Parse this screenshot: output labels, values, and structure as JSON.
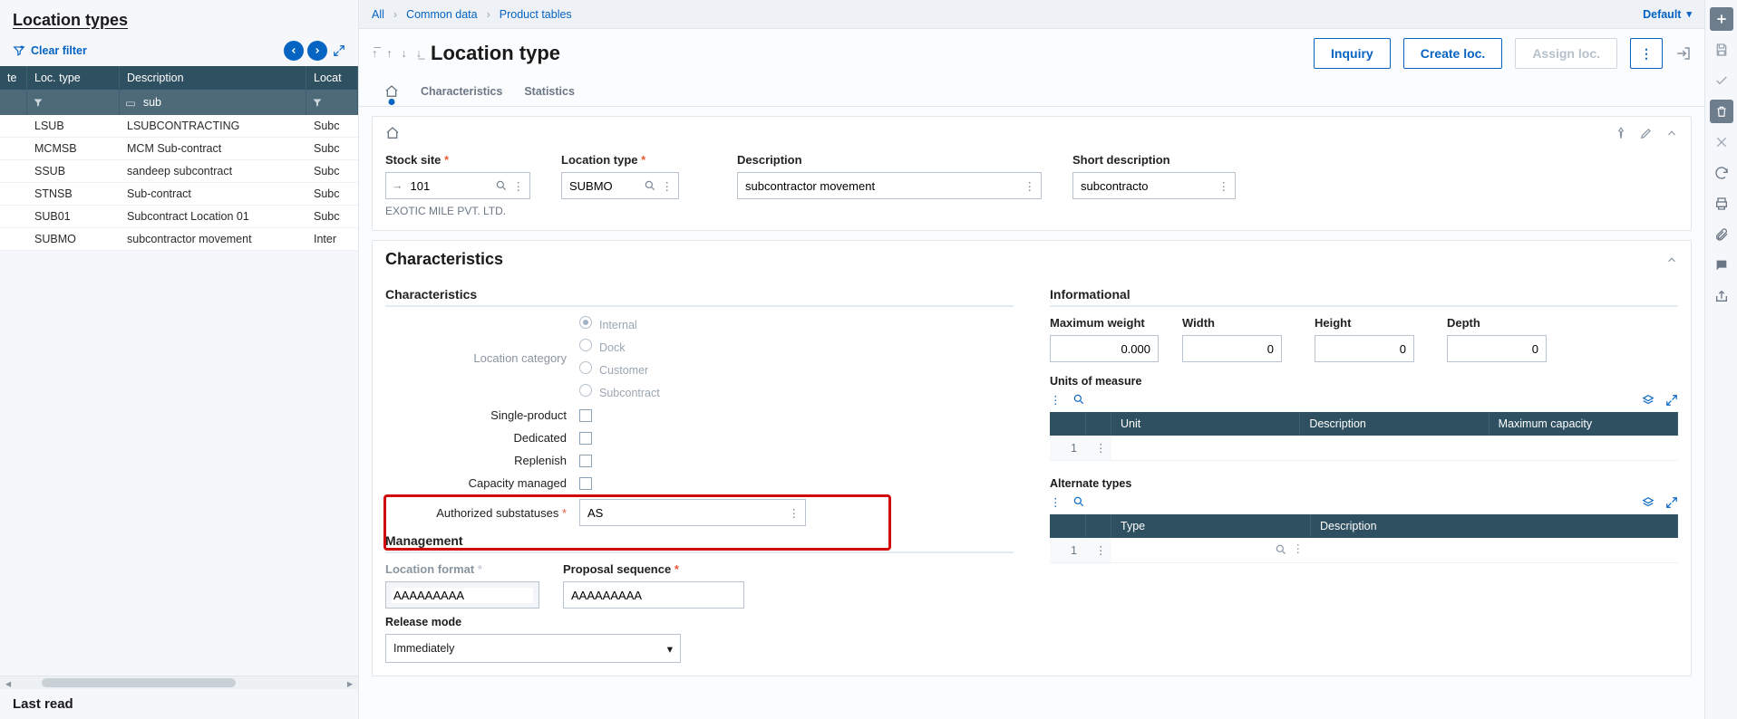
{
  "left_panel": {
    "title": "Location types",
    "clear_filter": "Clear filter",
    "columns": {
      "c0": "te",
      "c1": "Loc. type",
      "c2": "Description",
      "c3": "Locat"
    },
    "filter_text": "sub",
    "rows": [
      {
        "type": "LSUB",
        "desc": "LSUBCONTRACTING",
        "loc": "Subc"
      },
      {
        "type": "MCMSB",
        "desc": "MCM Sub-contract",
        "loc": "Subc"
      },
      {
        "type": "SSUB",
        "desc": "sandeep subcontract",
        "loc": "Subc"
      },
      {
        "type": "STNSB",
        "desc": "Sub-contract",
        "loc": "Subc"
      },
      {
        "type": "SUB01",
        "desc": "Subcontract Location 01",
        "loc": "Subc"
      },
      {
        "type": "SUBMO",
        "desc": "subcontractor movement",
        "loc": "Inter"
      }
    ],
    "last_read": "Last read"
  },
  "breadcrumbs": {
    "all": "All",
    "common": "Common data",
    "product": "Product tables",
    "default": "Default"
  },
  "page": {
    "title": "Location type",
    "actions": {
      "inquiry": "Inquiry",
      "create": "Create loc.",
      "assign": "Assign loc."
    },
    "tabs": {
      "t1": "Characteristics",
      "t2": "Statistics"
    }
  },
  "header_section": {
    "stock_site": {
      "label": "Stock site",
      "value": "101",
      "subtext": "EXOTIC MILE PVT. LTD."
    },
    "location_type": {
      "label": "Location type",
      "value": "SUBMO"
    },
    "description": {
      "label": "Description",
      "value": "subcontractor movement"
    },
    "short_desc": {
      "label": "Short description",
      "value": "subcontracto"
    }
  },
  "characteristics": {
    "title": "Characteristics",
    "subtitle": "Characteristics",
    "location_category_label": "Location category",
    "radios": [
      "Internal",
      "Dock",
      "Customer",
      "Subcontract"
    ],
    "flags": {
      "single_product": "Single-product",
      "dedicated": "Dedicated",
      "replenish": "Replenish",
      "capacity_managed": "Capacity managed"
    },
    "auth_substatus": {
      "label": "Authorized substatuses",
      "value": "AS"
    },
    "management": {
      "title": "Management",
      "location_format": {
        "label": "Location format",
        "value": "AAAAAAAAA"
      },
      "proposal_sequence": {
        "label": "Proposal sequence",
        "value": "AAAAAAAAA"
      },
      "release_mode": {
        "label": "Release mode",
        "value": "Immediately"
      }
    }
  },
  "informational": {
    "title": "Informational",
    "max_weight": {
      "label": "Maximum weight",
      "value": "0.000"
    },
    "width": {
      "label": "Width",
      "value": "0"
    },
    "height": {
      "label": "Height",
      "value": "0"
    },
    "depth": {
      "label": "Depth",
      "value": "0"
    },
    "uom": {
      "title": "Units of measure",
      "cols": {
        "unit": "Unit",
        "desc": "Description",
        "cap": "Maximum capacity"
      }
    },
    "alt": {
      "title": "Alternate types",
      "cols": {
        "type": "Type",
        "desc": "Description"
      }
    }
  }
}
